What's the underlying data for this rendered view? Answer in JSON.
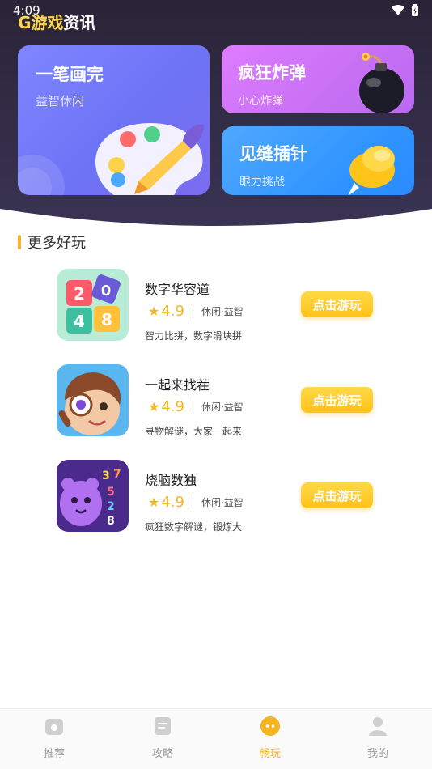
{
  "status": {
    "time": "4:09"
  },
  "app": {
    "logo_main": "游戏",
    "logo_accent": "资讯"
  },
  "featured": [
    {
      "title": "一笔画完",
      "subtitle": "益智休闲"
    },
    {
      "title": "疯狂炸弹",
      "subtitle": "小心炸弹"
    },
    {
      "title": "见缝插针",
      "subtitle": "眼力挑战"
    }
  ],
  "section": {
    "title": "更多好玩"
  },
  "games": [
    {
      "name": "数字华容道",
      "rating": "4.9",
      "category": "休闲·益智",
      "description": "智力比拼，数字滑块拼",
      "button": "点击游玩"
    },
    {
      "name": "一起来找茬",
      "rating": "4.9",
      "category": "休闲·益智",
      "description": "寻物解谜，大家一起来",
      "button": "点击游玩"
    },
    {
      "name": "烧脑数独",
      "rating": "4.9",
      "category": "休闲·益智",
      "description": "疯狂数字解谜，锻炼大",
      "button": "点击游玩"
    }
  ],
  "nav": [
    {
      "label": "推荐"
    },
    {
      "label": "攻略"
    },
    {
      "label": "畅玩"
    },
    {
      "label": "我的"
    }
  ],
  "colors": {
    "accent": "#f5b522",
    "hero_bg": "#2d2840"
  }
}
